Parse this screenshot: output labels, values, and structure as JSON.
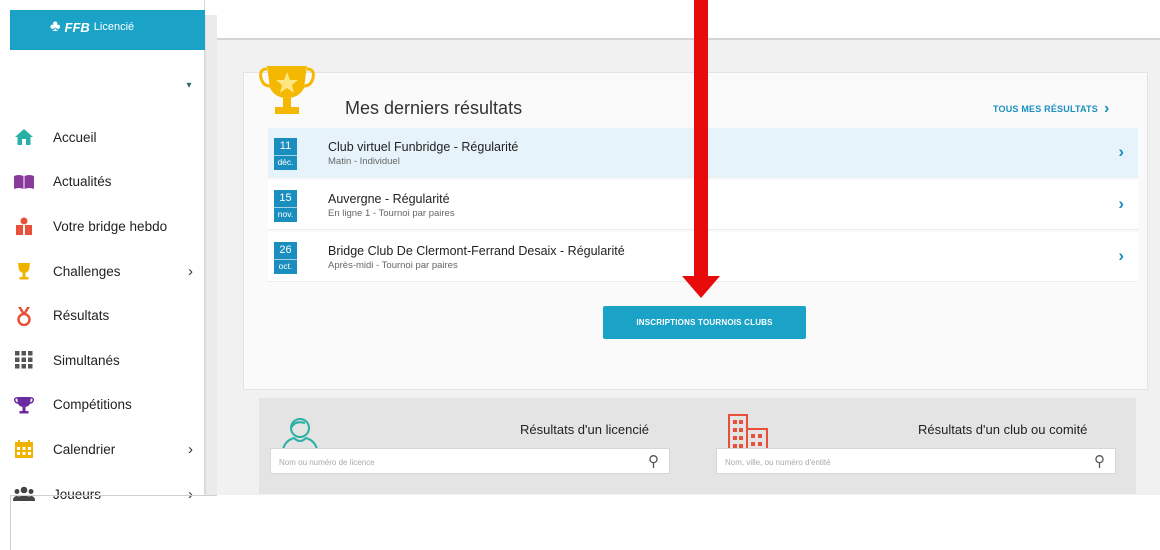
{
  "app": {
    "brand": "FFB",
    "brand_sub": "Licencié"
  },
  "sidebar": {
    "items": [
      {
        "label": "Accueil",
        "icon": "home-icon",
        "color": "#2bb0a5",
        "has_submenu": false
      },
      {
        "label": "Actualités",
        "icon": "book-icon",
        "color": "#8a3a9b",
        "has_submenu": false
      },
      {
        "label": "Votre bridge hebdo",
        "icon": "gift-icon",
        "color": "#e8503a",
        "has_submenu": false
      },
      {
        "label": "Challenges",
        "icon": "trophy-icon",
        "color": "#f0b400",
        "has_submenu": true
      },
      {
        "label": "Résultats",
        "icon": "medal-icon",
        "color": "#e8503a",
        "has_submenu": false
      },
      {
        "label": "Simultanés",
        "icon": "grid-icon",
        "color": "#333333",
        "has_submenu": false
      },
      {
        "label": "Compétitions",
        "icon": "cup-icon",
        "color": "#6a2aa0",
        "has_submenu": false
      },
      {
        "label": "Calendrier",
        "icon": "calendar-icon",
        "color": "#f0b400",
        "has_submenu": true
      },
      {
        "label": "Joueurs",
        "icon": "players-icon",
        "color": "#333333",
        "has_submenu": true
      }
    ]
  },
  "results": {
    "title": "Mes derniers résultats",
    "all_link": "TOUS MES RÉSULTATS",
    "rows": [
      {
        "day": "11",
        "month": "déc.",
        "title": "Club virtuel Funbridge - Régularité",
        "subtitle": "Matin - Individuel"
      },
      {
        "day": "15",
        "month": "nov.",
        "title": "Auvergne - Régularité",
        "subtitle": "En ligne 1 - Tournoi par paires"
      },
      {
        "day": "26",
        "month": "oct.",
        "title": "Bridge Club De Clermont-Ferrand Desaix - Régularité",
        "subtitle": "Après-midi - Tournoi par paires"
      }
    ],
    "cta_label": "INSCRIPTIONS TOURNOIS CLUBS"
  },
  "search": {
    "player_label": "Résultats d'un licencié",
    "player_placeholder": "Nom ou numéro de licence",
    "club_label": "Résultats d'un club ou comité",
    "club_placeholder": "Nom, ville, ou numéro d'entité"
  },
  "colors": {
    "accent": "#1aa3c7",
    "link": "#1a8fbf",
    "arrow": "#e80b0b"
  }
}
